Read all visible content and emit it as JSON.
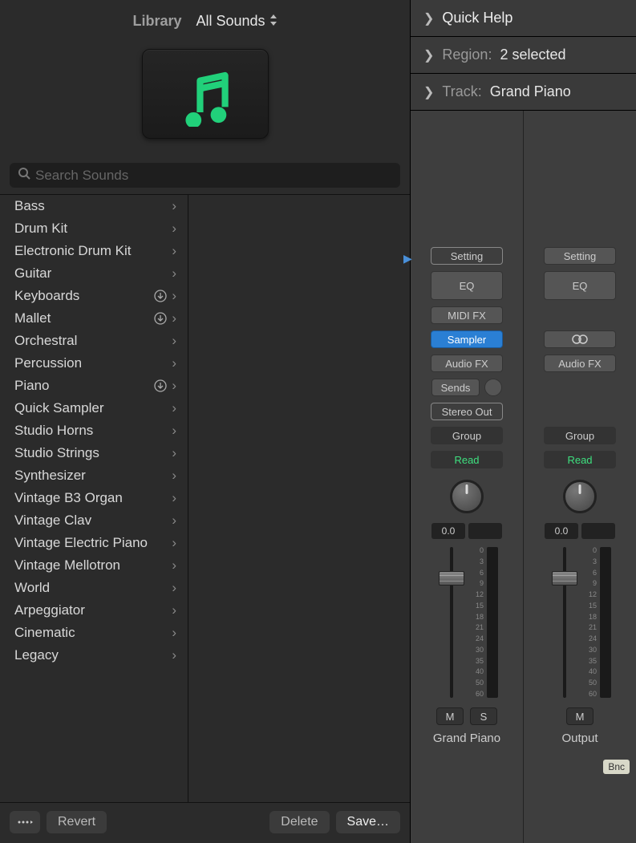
{
  "library": {
    "title": "Library",
    "dropdown": "All Sounds",
    "search_placeholder": "Search Sounds",
    "categories": [
      {
        "label": "Bass",
        "download": false
      },
      {
        "label": "Drum Kit",
        "download": false
      },
      {
        "label": "Electronic Drum Kit",
        "download": false
      },
      {
        "label": "Guitar",
        "download": false
      },
      {
        "label": "Keyboards",
        "download": true
      },
      {
        "label": "Mallet",
        "download": true
      },
      {
        "label": "Orchestral",
        "download": false
      },
      {
        "label": "Percussion",
        "download": false
      },
      {
        "label": "Piano",
        "download": true
      },
      {
        "label": "Quick Sampler",
        "download": false
      },
      {
        "label": "Studio Horns",
        "download": false
      },
      {
        "label": "Studio Strings",
        "download": false
      },
      {
        "label": "Synthesizer",
        "download": false
      },
      {
        "label": "Vintage B3 Organ",
        "download": false
      },
      {
        "label": "Vintage Clav",
        "download": false
      },
      {
        "label": "Vintage Electric Piano",
        "download": false
      },
      {
        "label": "Vintage Mellotron",
        "download": false
      },
      {
        "label": "World",
        "download": false
      },
      {
        "label": "Arpeggiator",
        "download": false
      },
      {
        "label": "Cinematic",
        "download": false
      },
      {
        "label": "Legacy",
        "download": false
      }
    ],
    "footer": {
      "revert": "Revert",
      "delete": "Delete",
      "save": "Save…"
    }
  },
  "inspector": {
    "quick_help": "Quick Help",
    "region_label": "Region:",
    "region_value": "2 selected",
    "track_label": "Track:",
    "track_value": "Grand Piano"
  },
  "strips": [
    {
      "name": "Grand Piano",
      "setting": "Setting",
      "eq": "EQ",
      "midi_fx": "MIDI FX",
      "instrument": "Sampler",
      "audio_fx": "Audio FX",
      "sends": "Sends",
      "output": "Stereo Out",
      "group": "Group",
      "automation": "Read",
      "db": "0.0",
      "mute": "M",
      "solo": "S",
      "scale": [
        "0",
        "3",
        "6",
        "9",
        "12",
        "15",
        "18",
        "21",
        "24",
        "30",
        "35",
        "40",
        "50",
        "60"
      ]
    },
    {
      "name": "Output",
      "setting": "Setting",
      "eq": "EQ",
      "audio_fx": "Audio FX",
      "group": "Group",
      "automation": "Read",
      "db": "0.0",
      "mute": "M",
      "bounce": "Bnc",
      "scale": [
        "0",
        "3",
        "6",
        "9",
        "12",
        "15",
        "18",
        "21",
        "24",
        "30",
        "35",
        "40",
        "50",
        "60"
      ]
    }
  ]
}
